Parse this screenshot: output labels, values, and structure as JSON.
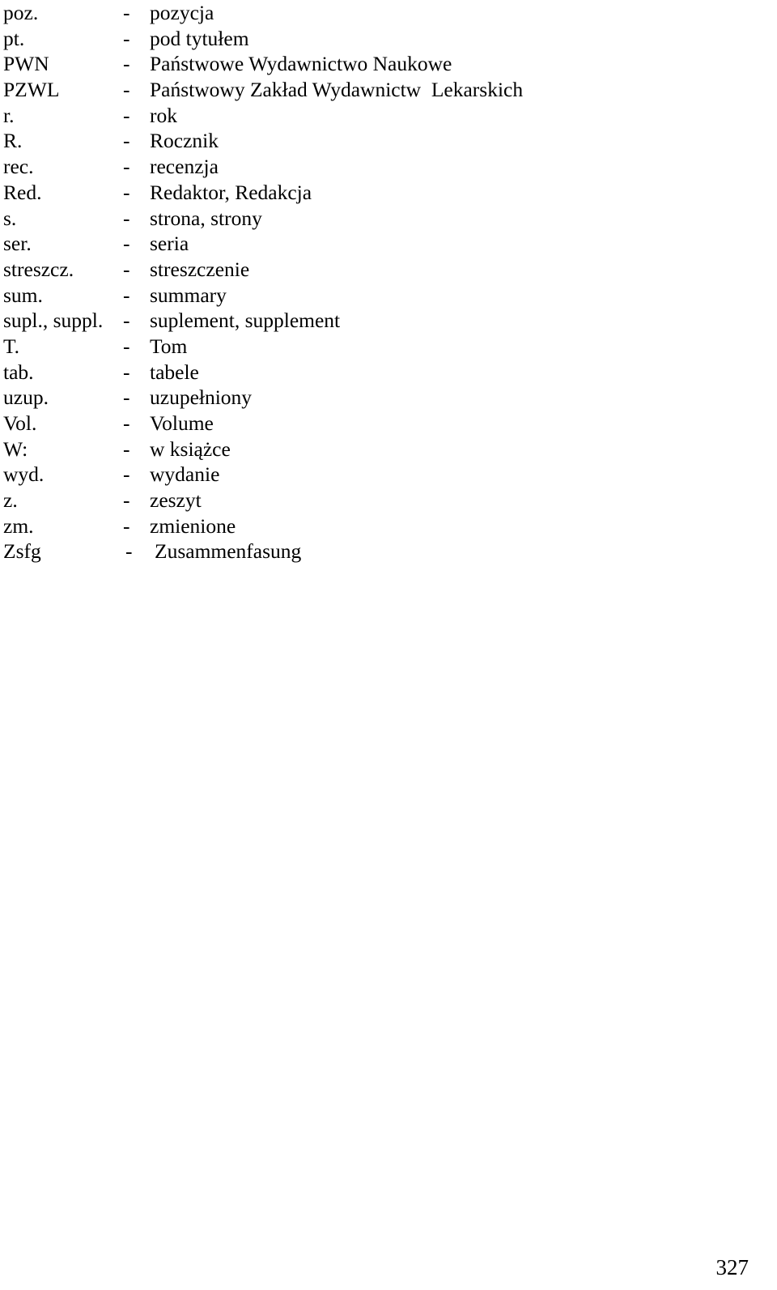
{
  "document": {
    "type": "abbreviation-list",
    "separator": "-",
    "page_number": "327",
    "entries": [
      {
        "term": "poz.",
        "definition": "pozycja"
      },
      {
        "term": "pt.",
        "definition": "pod tytułem"
      },
      {
        "term": "PWN",
        "definition": "Państwowe Wydawnictwo Naukowe"
      },
      {
        "term": "PZWL",
        "definition": "Państwowy Zakład Wydawnictw  Lekarskich"
      },
      {
        "term": "r.",
        "definition": "rok"
      },
      {
        "term": "R.",
        "definition": "Rocznik"
      },
      {
        "term": "rec.",
        "definition": "recenzja"
      },
      {
        "term": "Red.",
        "definition": "Redaktor, Redakcja"
      },
      {
        "term": "s.",
        "definition": "strona, strony"
      },
      {
        "term": "ser.",
        "definition": "seria"
      },
      {
        "term": "streszcz.",
        "definition": "streszczenie"
      },
      {
        "term": "sum.",
        "definition": "summary"
      },
      {
        "term": "supl., suppl.",
        "definition": "suplement, supplement"
      },
      {
        "term": "T.",
        "definition": "Tom"
      },
      {
        "term": "tab.",
        "definition": "tabele"
      },
      {
        "term": "uzup.",
        "definition": "uzupełniony"
      },
      {
        "term": "Vol.",
        "definition": "Volume"
      },
      {
        "term": "W:",
        "definition": "w książce"
      },
      {
        "term": "wyd.",
        "definition": "wydanie"
      },
      {
        "term": "z.",
        "definition": "zeszyt"
      },
      {
        "term": "zm.",
        "definition": "zmienione"
      },
      {
        "term": "Zsfg",
        "definition": "Zusammenfasung"
      }
    ]
  }
}
